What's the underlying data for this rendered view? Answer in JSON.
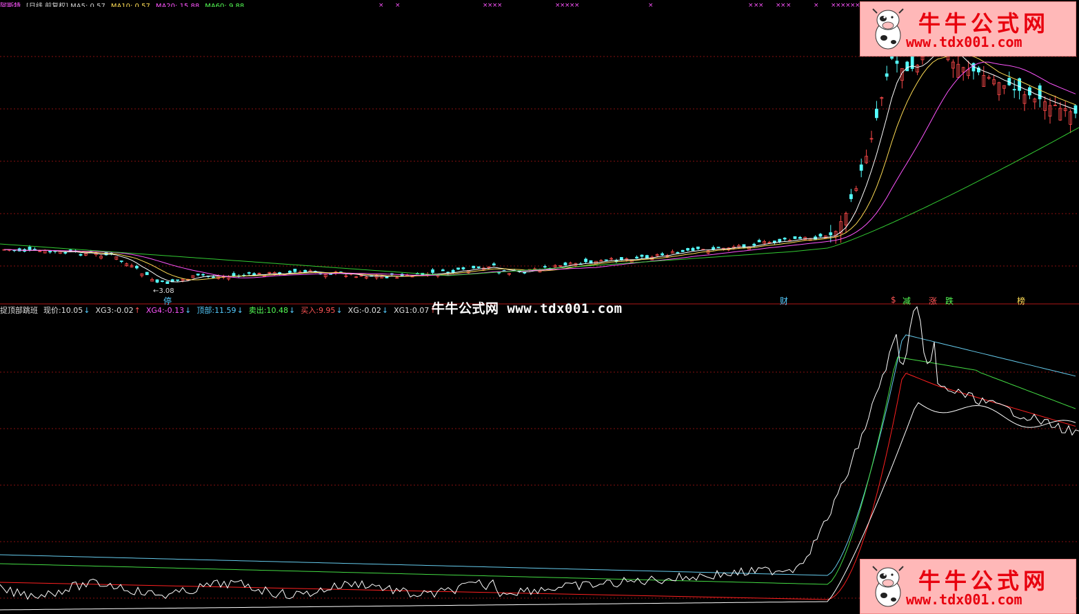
{
  "header": {
    "items": [
      {
        "text": "阿斯特",
        "color": "#ff55ff"
      },
      {
        "text": "[日线,前复权] MA5: 0.57",
        "color": "#d0d0d0"
      },
      {
        "text": "MA10: 0.57",
        "color": "#ffdd55"
      },
      {
        "text": "MA20: 15.88",
        "color": "#ff55ff"
      },
      {
        "text": "MA60: 9.88",
        "color": "#55ff55"
      }
    ]
  },
  "price_label": "3.08",
  "top_tags": [
    {
      "text": "停",
      "color": "#55ccff"
    },
    {
      "text": "财",
      "color": "#55ccff"
    },
    {
      "text": "$",
      "color": "#ff5555"
    },
    {
      "text": "减",
      "color": "#55ff55"
    },
    {
      "text": "涨",
      "color": "#ff5555"
    },
    {
      "text": "跌",
      "color": "#55ff55"
    },
    {
      "text": "榜",
      "color": "#ffdd55"
    }
  ],
  "indicator_bar": {
    "name": "捉顶部跳班",
    "items": [
      {
        "label": "现价:",
        "value": "10.05",
        "arrow": "↓",
        "color": "#e0e0e0",
        "arrow_color": "#55ccff"
      },
      {
        "label": "XG3:",
        "value": "-0.02",
        "arrow": "↑",
        "color": "#e0e0e0",
        "arrow_color": "#ff5555"
      },
      {
        "label": "XG4:",
        "value": "-0.13",
        "arrow": "↓",
        "color": "#ff55ff",
        "arrow_color": "#55ccff"
      },
      {
        "label": "顶部:",
        "value": "11.59",
        "arrow": "↓",
        "color": "#55ccff",
        "arrow_color": "#55ccff"
      },
      {
        "label": "卖出:",
        "value": "10.48",
        "arrow": "↓",
        "color": "#55ff55",
        "arrow_color": "#55ccff"
      },
      {
        "label": "买入:",
        "value": "9.95",
        "arrow": "↓",
        "color": "#ff5555",
        "arrow_color": "#55ccff"
      },
      {
        "label": "XG:",
        "value": "-0.02",
        "arrow": "↓",
        "color": "#e0e0e0",
        "arrow_color": "#55ccff"
      },
      {
        "label": "XG1:",
        "value": "0.07",
        "arrow": "↑",
        "color": "#e0e0e0",
        "arrow_color": "#ff5555"
      }
    ]
  },
  "watermark": {
    "center_text": "牛牛公式网 www.tdx001.com",
    "brand_title": "牛牛公式网",
    "brand_url": "www.tdx001.com"
  },
  "colors": {
    "grid": "#8a1010",
    "up_candle": "#ff4a4a",
    "down_candle": "#55ffff",
    "ma5": "#ffffff",
    "ma10": "#ffdd55",
    "ma20": "#ff55ff",
    "ma60": "#33cc33",
    "ind_white": "#ffffff",
    "ind_red": "#ff2020",
    "ind_green": "#44dd44",
    "ind_cyan": "#66ccee",
    "marker": "#ff55ff"
  }
}
